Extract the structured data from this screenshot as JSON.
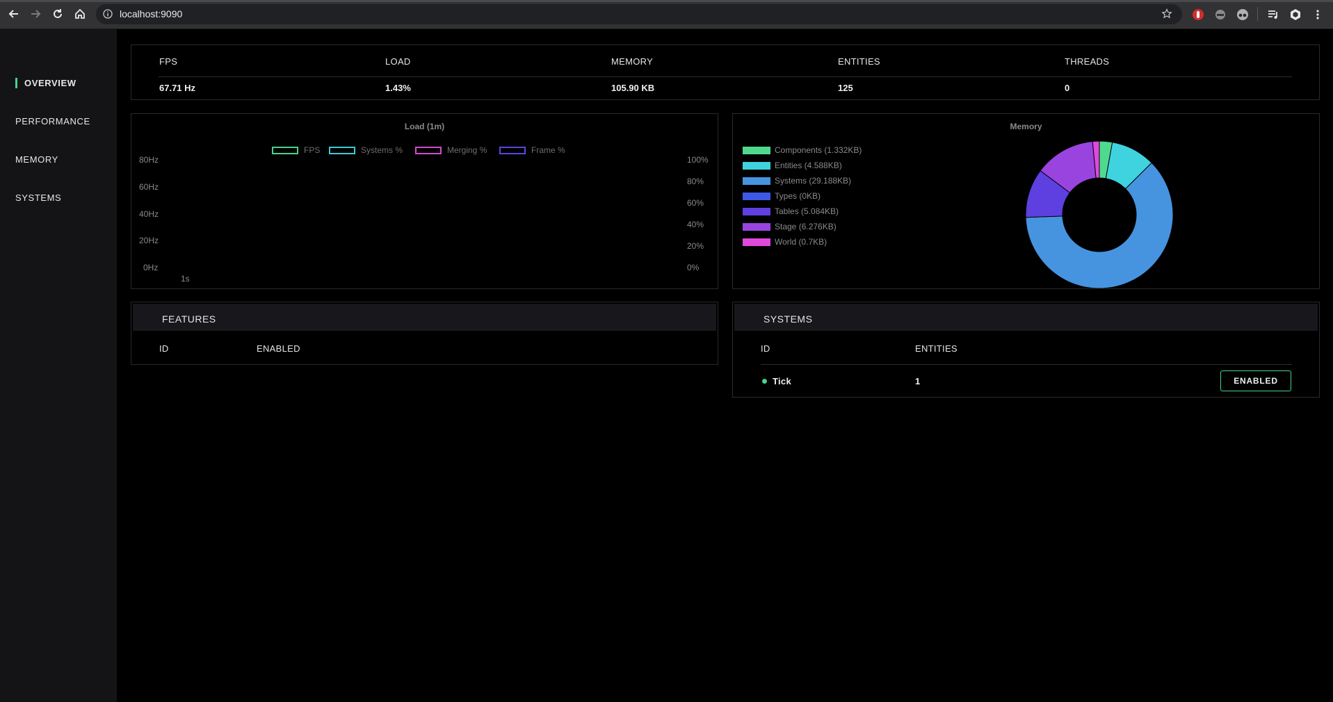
{
  "browser": {
    "url": "localhost:9090"
  },
  "sidebar": {
    "items": [
      {
        "label": "OVERVIEW",
        "active": true
      },
      {
        "label": "PERFORMANCE",
        "active": false
      },
      {
        "label": "MEMORY",
        "active": false
      },
      {
        "label": "SYSTEMS",
        "active": false
      }
    ],
    "accent": "#46d48e"
  },
  "stats": [
    {
      "label": "FPS",
      "value": "67.71 Hz"
    },
    {
      "label": "LOAD",
      "value": "1.43%"
    },
    {
      "label": "MEMORY",
      "value": "105.90 KB"
    },
    {
      "label": "ENTITIES",
      "value": "125"
    },
    {
      "label": "THREADS",
      "value": "0"
    }
  ],
  "load_chart": {
    "title": "Load (1m)",
    "legend": [
      {
        "label": "FPS",
        "color": "#46d48e"
      },
      {
        "label": "Systems %",
        "color": "#3ec9d6"
      },
      {
        "label": "Merging %",
        "color": "#d24ad0"
      },
      {
        "label": "Frame %",
        "color": "#5a46e0"
      }
    ],
    "left_ticks": [
      "80Hz",
      "60Hz",
      "40Hz",
      "20Hz",
      "0Hz"
    ],
    "right_ticks": [
      "100%",
      "80%",
      "60%",
      "40%",
      "20%",
      "0%"
    ],
    "x_tick": "1s"
  },
  "chart_data": {
    "type": "pie",
    "title": "Memory",
    "categories": [
      "Components (1.332KB)",
      "Entities (4.588KB)",
      "Systems (29.188KB)",
      "Types (0KB)",
      "Tables (5.084KB)",
      "Stage (6.276KB)",
      "World (0.7KB)"
    ],
    "values": [
      1.332,
      4.588,
      29.188,
      0,
      5.084,
      6.276,
      0.7
    ],
    "colors": [
      "#4fd98f",
      "#3fd3e0",
      "#4694e0",
      "#3c5ae6",
      "#5e3fe0",
      "#9a44e0",
      "#e048dc"
    ]
  },
  "features": {
    "title": "FEATURES",
    "columns": [
      "ID",
      "ENABLED"
    ]
  },
  "systems": {
    "title": "SYSTEMS",
    "columns": [
      "ID",
      "ENTITIES"
    ],
    "rows": [
      {
        "id": "Tick",
        "entities": "1",
        "status": "ENABLED"
      }
    ]
  }
}
